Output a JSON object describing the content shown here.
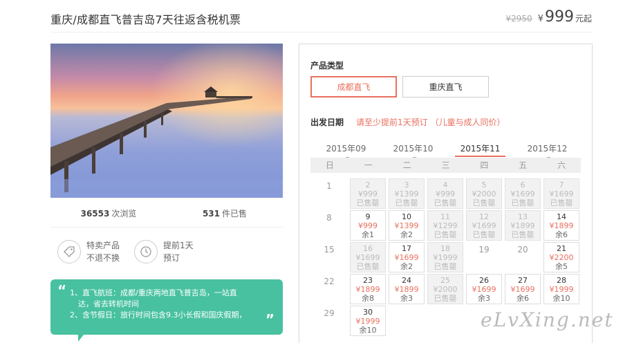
{
  "header": {
    "title": "重庆/成都直飞普吉岛7天往返含税机票",
    "original_price": "¥2950",
    "currency": "¥",
    "price": "999",
    "price_suffix": "元起"
  },
  "stats": {
    "views": "36553",
    "views_label": "次浏览",
    "sold": "531",
    "sold_label": "件已售"
  },
  "features": [
    {
      "icon": "tag-icon",
      "line1": "特卖产品",
      "line2": "不退不换"
    },
    {
      "icon": "clock-icon",
      "line1": "提前1天",
      "line2": "预订"
    }
  ],
  "highlights": {
    "lines": [
      "1、直飞航班：成都/重庆两地直飞普吉岛，一站直",
      "达，省去转机时间",
      "2、含节假日：旅行时间包含9.3小长假和国庆假期，"
    ],
    "open_quote": "“",
    "close_quote": "”"
  },
  "booking": {
    "product_type_label": "产品类型",
    "types": [
      "成都直飞",
      "重庆直飞"
    ],
    "selected_type": "成都直飞",
    "date_label": "出发日期",
    "date_note": "请至少提前1天预订 （儿童与成人同价）",
    "months": [
      "2015年09",
      "2015年10",
      "2015年11",
      "2015年12"
    ],
    "selected_month": "2015年11",
    "weekdays": [
      "日",
      "一",
      "二",
      "三",
      "四",
      "五",
      "六"
    ],
    "weeks": [
      {
        "num": "1",
        "days": [
          {
            "d": "2",
            "p": "¥999",
            "s": "已售罄",
            "past": true
          },
          {
            "d": "3",
            "p": "¥1399",
            "s": "已售罄",
            "past": true
          },
          {
            "d": "4",
            "p": "¥999",
            "s": "已售罄",
            "past": true
          },
          {
            "d": "5",
            "p": "¥2000",
            "s": "已售罄",
            "past": true
          },
          {
            "d": "6",
            "p": "¥1699",
            "s": "已售罄",
            "past": true
          },
          {
            "d": "7",
            "p": "¥1699",
            "s": "已售罄",
            "past": true
          }
        ]
      },
      {
        "num": "8",
        "days": [
          {
            "d": "9",
            "p": "¥999",
            "s": "余1",
            "past": false
          },
          {
            "d": "10",
            "p": "¥1399",
            "s": "余2",
            "past": false
          },
          {
            "d": "11",
            "p": "¥1299",
            "s": "已售罄",
            "past": true
          },
          {
            "d": "12",
            "p": "¥1699",
            "s": "已售罄",
            "past": true
          },
          {
            "d": "13",
            "p": "¥1899",
            "s": "已售罄",
            "past": true
          },
          {
            "d": "14",
            "p": "¥1899",
            "s": "余6",
            "past": false
          }
        ]
      },
      {
        "num": "15",
        "days": [
          {
            "d": "16",
            "p": "¥1699",
            "s": "已售罄",
            "past": true
          },
          {
            "d": "17",
            "p": "¥1699",
            "s": "余2",
            "past": false
          },
          {
            "d": "18",
            "p": "¥1999",
            "s": "已售罄",
            "past": true
          },
          {
            "d": "19",
            "plain": true
          },
          {
            "d": "20",
            "plain": true
          },
          {
            "d": "21",
            "p": "¥2200",
            "s": "余5",
            "past": false
          }
        ]
      },
      {
        "num": "22",
        "days": [
          {
            "d": "23",
            "p": "¥1899",
            "s": "余8",
            "past": false
          },
          {
            "d": "24",
            "p": "¥1899",
            "s": "余3",
            "past": false
          },
          {
            "d": "25",
            "p": "¥2000",
            "s": "已售罄",
            "past": true
          },
          {
            "d": "26",
            "p": "¥1699",
            "s": "余3",
            "past": false
          },
          {
            "d": "27",
            "p": "¥1699",
            "s": "余6",
            "past": false
          },
          {
            "d": "28",
            "p": "¥1999",
            "s": "余10",
            "past": false
          }
        ]
      },
      {
        "num": "29",
        "days": [
          {
            "d": "30",
            "p": "¥1999",
            "s": "余10",
            "past": false
          }
        ]
      }
    ]
  },
  "watermark": "eLvXing.net",
  "colors": {
    "accent": "#e8705e",
    "highlight_bg": "#48c1a0"
  }
}
